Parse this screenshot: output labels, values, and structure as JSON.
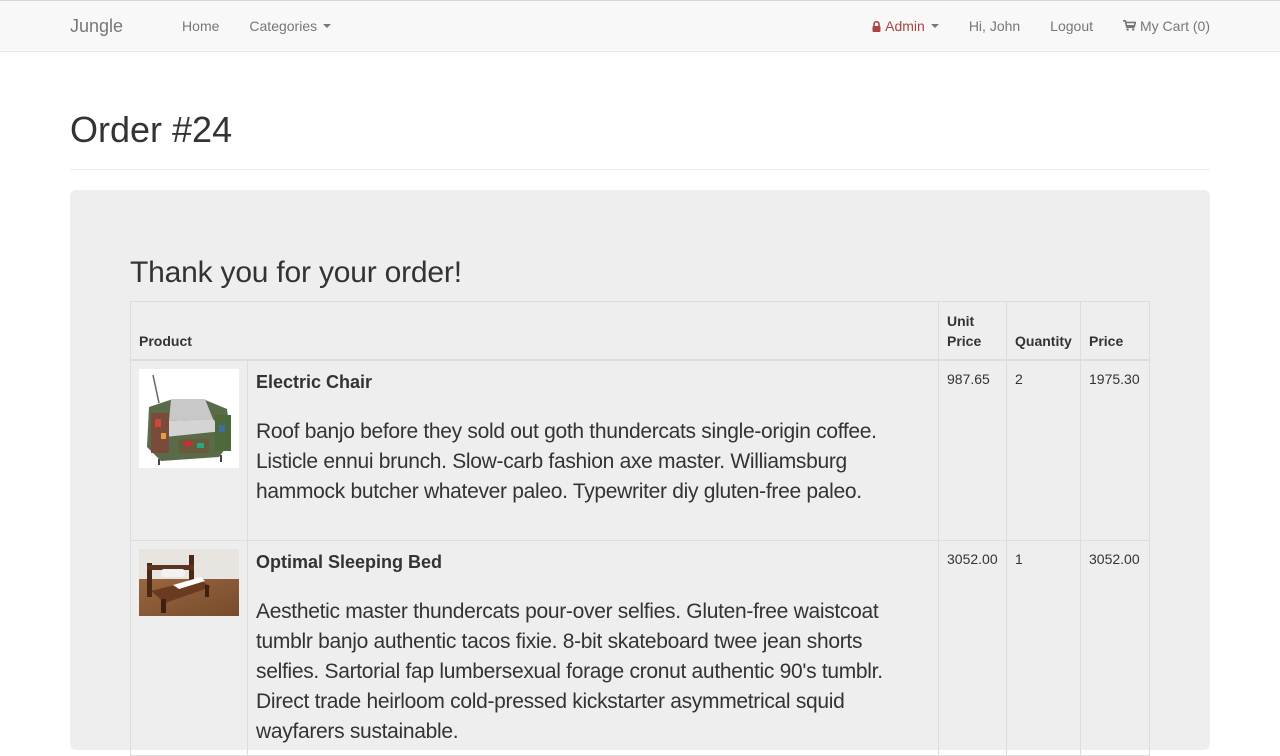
{
  "nav": {
    "brand": "Jungle",
    "home": "Home",
    "categories": "Categories",
    "admin": "Admin",
    "greeting": "Hi, John",
    "logout": "Logout",
    "cart": "My Cart (0)"
  },
  "page": {
    "title": "Order #24"
  },
  "order": {
    "heading": "Thank you for your order!",
    "columns": {
      "product": "Product",
      "unit_price": "Unit Price",
      "quantity": "Quantity",
      "price": "Price"
    },
    "items": [
      {
        "name": "Electric Chair",
        "description": "Roof banjo before they sold out goth thundercats single-origin coffee. Listicle ennui brunch. Slow-carb fashion axe master. Williamsburg hammock butcher whatever paleo. Typewriter diy gluten-free paleo.",
        "unit_price": "987.65",
        "quantity": "2",
        "price": "1975.30"
      },
      {
        "name": "Optimal Sleeping Bed",
        "description": "Aesthetic master thundercats pour-over selfies. Gluten-free waistcoat tumblr banjo authentic tacos fixie. 8-bit skateboard twee jean shorts selfies. Sartorial fap lumbersexual forage cronut authentic 90's tumblr. Direct trade heirloom cold-pressed kickstarter asymmetrical squid wayfarers sustainable.",
        "unit_price": "3052.00",
        "quantity": "1",
        "price": "3052.00"
      }
    ]
  },
  "colors": {
    "navbar_bg": "#f8f8f8",
    "nav_text": "#777777",
    "admin": "#a94442",
    "panel_bg": "#eeeeee"
  },
  "icons": {
    "admin": "lock-icon",
    "cart": "shopping-cart-icon",
    "dropdown": "caret-down-icon"
  }
}
